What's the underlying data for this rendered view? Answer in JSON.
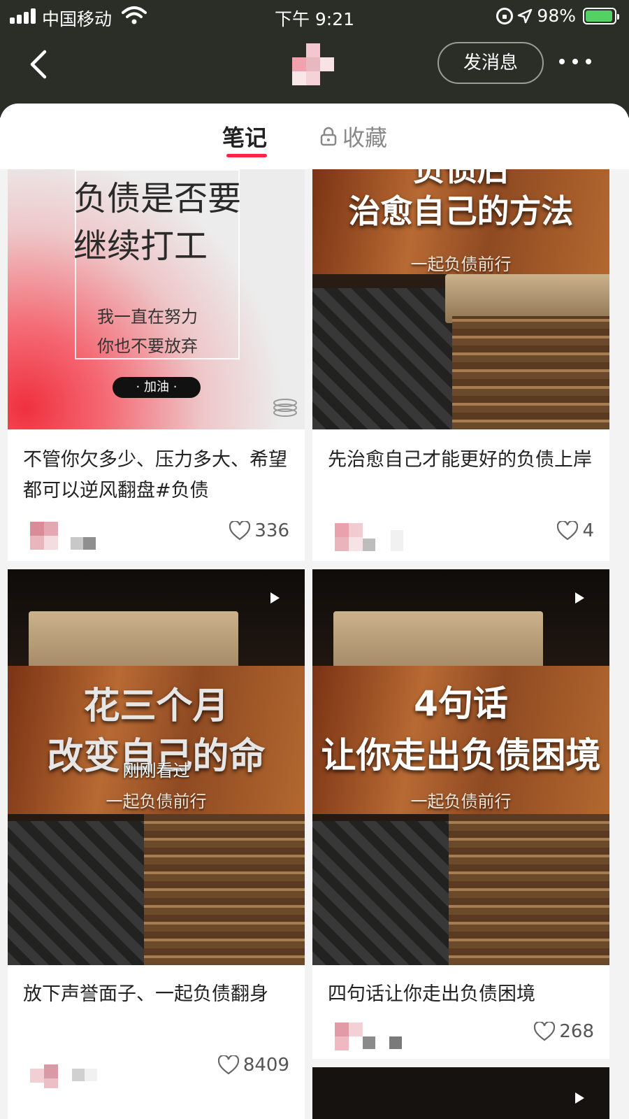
{
  "status_bar": {
    "carrier": "中国移动",
    "time": "下午 9:21",
    "battery": "98%"
  },
  "header": {
    "message_button": "发消息"
  },
  "tabs": {
    "notes": "笔记",
    "favorites": "收藏"
  },
  "notes": [
    {
      "cover_title_lines": [
        "负债是否要",
        "继续打工"
      ],
      "cover_body_lines": [
        "我一直在努力",
        "你也不要放弃"
      ],
      "cover_pill": "· 加油 ·",
      "title": "不管你欠多少、压力多大、希望都可以逆风翻盘#负债",
      "likes": "336"
    },
    {
      "cover_title_lines": [
        "负债后",
        "治愈自己的方法"
      ],
      "cover_subtitle": "一起负债前行",
      "title": "先治愈自己才能更好的负债上岸",
      "likes": "4"
    },
    {
      "cover_title_lines": [
        "花三个月",
        "改变自己的命"
      ],
      "cover_subtitle": "一起负债前行",
      "cover_overlay": "刚刚看过",
      "title": "放下声誉面子、一起负债翻身",
      "likes": "8409"
    },
    {
      "cover_title_lines": [
        "4句话",
        "让你走出负债困境"
      ],
      "cover_subtitle": "一起负债前行",
      "title": "四句话让你走出负债困境",
      "likes": "268"
    }
  ],
  "colors": {
    "header_bg": "#2b2e27",
    "accent": "#ff2442",
    "battery": "#54d163"
  }
}
